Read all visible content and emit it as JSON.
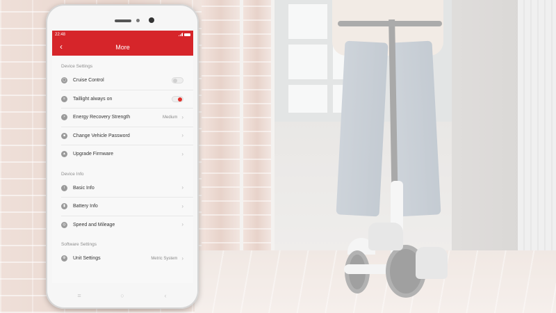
{
  "status_bar": {
    "time": "22:48"
  },
  "header": {
    "title": "More",
    "back_icon": "chevron-left-icon"
  },
  "sections": {
    "device_settings": {
      "header": "Device Settings",
      "items": [
        {
          "label": "Cruise Control",
          "icon": "speedometer-icon",
          "toggle": "off"
        },
        {
          "label": "Taillight always on",
          "icon": "light-icon",
          "toggle": "on"
        },
        {
          "label": "Energy Recovery Strength",
          "icon": "bolt-icon",
          "value": "Medium"
        },
        {
          "label": "Change Vehicle Password",
          "icon": "lock-icon"
        },
        {
          "label": "Upgrade Firmware",
          "icon": "upgrade-icon"
        }
      ]
    },
    "device_info": {
      "header": "Device Info",
      "items": [
        {
          "label": "Basic Info",
          "icon": "info-icon"
        },
        {
          "label": "Battery Info",
          "icon": "battery-icon"
        },
        {
          "label": "Speed and Mileage",
          "icon": "odometer-icon"
        }
      ]
    },
    "software_settings": {
      "header": "Software Settings",
      "items": [
        {
          "label": "Unit Settings",
          "icon": "gear-icon",
          "value": "Metric System"
        }
      ]
    }
  },
  "nav_bar": {
    "menu": "≡",
    "home": "○",
    "back": "‹"
  },
  "colors": {
    "accent": "#d6252a",
    "toggle_on": "#e0302b"
  }
}
